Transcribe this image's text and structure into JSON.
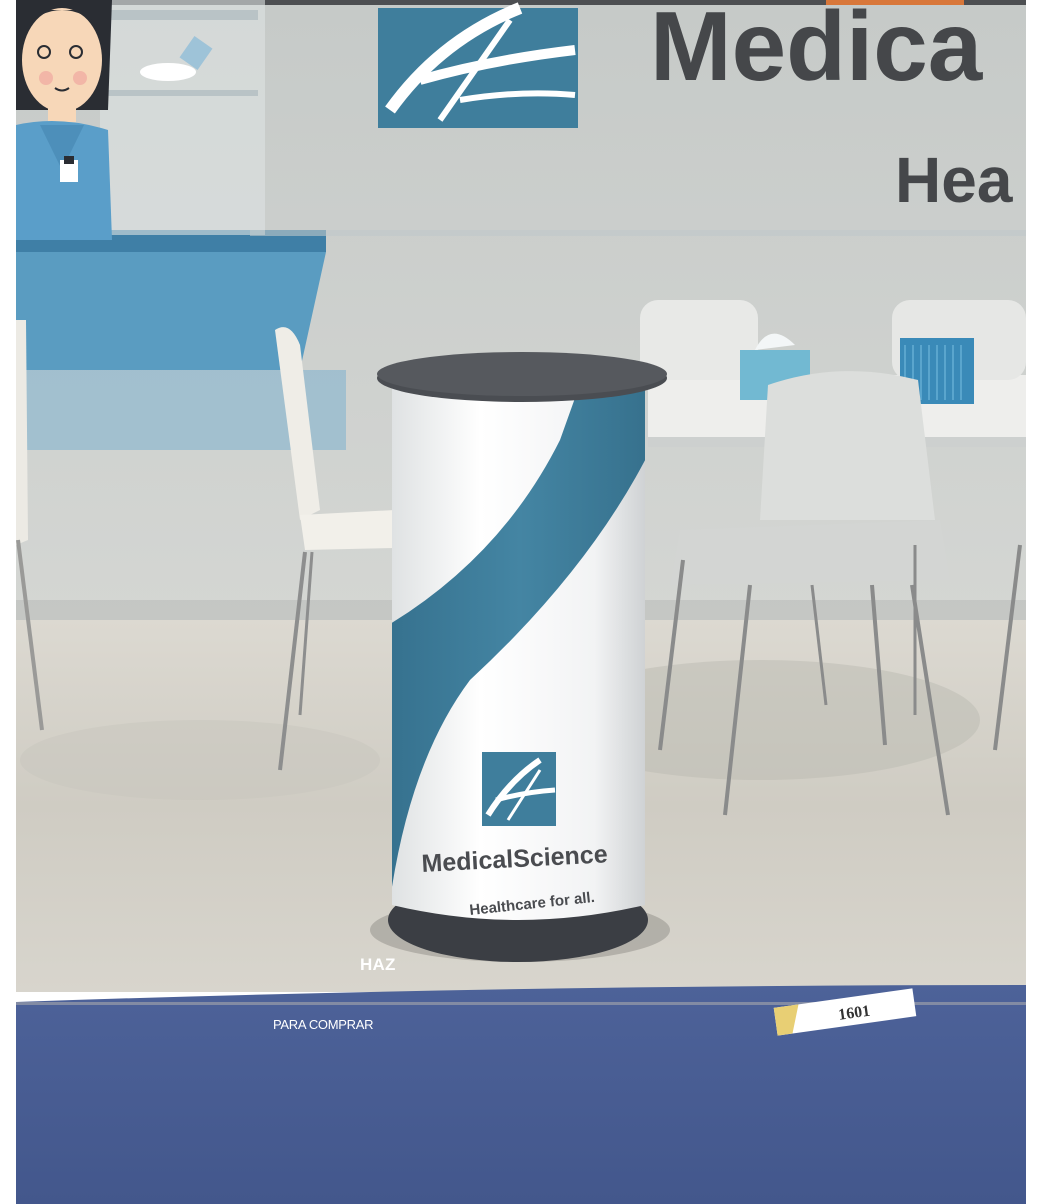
{
  "wall": {
    "brand_title": "Medica",
    "brand_subtitle": "Hea"
  },
  "podium": {
    "brand_name": "MedicalScience",
    "tagline": "Healthcare for all."
  },
  "floor_tag": {
    "number": "1601"
  },
  "overlay": {
    "heading": "HAZ",
    "cta": "PARA COMPRAR"
  },
  "colors": {
    "brand_teal": "#3f7e9c",
    "wall": "#c9ccc9",
    "carpet_light": "#d5d2ca",
    "carpet_blue": "#4a5e96",
    "podium_top": "#44474c"
  }
}
